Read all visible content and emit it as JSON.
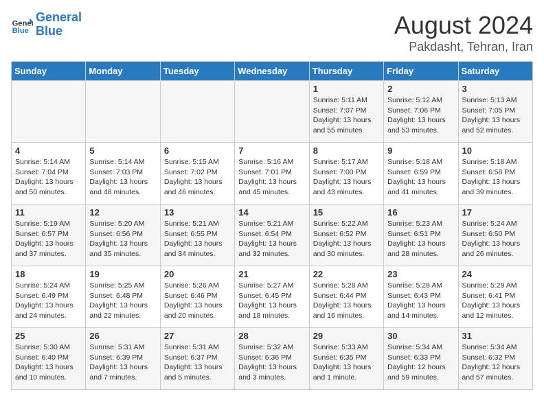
{
  "header": {
    "logo_line1": "General",
    "logo_line2": "Blue",
    "title": "August 2024",
    "subtitle": "Pakdasht, Tehran, Iran"
  },
  "days_of_week": [
    "Sunday",
    "Monday",
    "Tuesday",
    "Wednesday",
    "Thursday",
    "Friday",
    "Saturday"
  ],
  "weeks": [
    [
      {
        "day": "",
        "info": ""
      },
      {
        "day": "",
        "info": ""
      },
      {
        "day": "",
        "info": ""
      },
      {
        "day": "",
        "info": ""
      },
      {
        "day": "1",
        "info": "Sunrise: 5:11 AM\nSunset: 7:07 PM\nDaylight: 13 hours\nand 55 minutes."
      },
      {
        "day": "2",
        "info": "Sunrise: 5:12 AM\nSunset: 7:06 PM\nDaylight: 13 hours\nand 53 minutes."
      },
      {
        "day": "3",
        "info": "Sunrise: 5:13 AM\nSunset: 7:05 PM\nDaylight: 13 hours\nand 52 minutes."
      }
    ],
    [
      {
        "day": "4",
        "info": "Sunrise: 5:14 AM\nSunset: 7:04 PM\nDaylight: 13 hours\nand 50 minutes."
      },
      {
        "day": "5",
        "info": "Sunrise: 5:14 AM\nSunset: 7:03 PM\nDaylight: 13 hours\nand 48 minutes."
      },
      {
        "day": "6",
        "info": "Sunrise: 5:15 AM\nSunset: 7:02 PM\nDaylight: 13 hours\nand 46 minutes."
      },
      {
        "day": "7",
        "info": "Sunrise: 5:16 AM\nSunset: 7:01 PM\nDaylight: 13 hours\nand 45 minutes."
      },
      {
        "day": "8",
        "info": "Sunrise: 5:17 AM\nSunset: 7:00 PM\nDaylight: 13 hours\nand 43 minutes."
      },
      {
        "day": "9",
        "info": "Sunrise: 5:18 AM\nSunset: 6:59 PM\nDaylight: 13 hours\nand 41 minutes."
      },
      {
        "day": "10",
        "info": "Sunrise: 5:18 AM\nSunset: 6:58 PM\nDaylight: 13 hours\nand 39 minutes."
      }
    ],
    [
      {
        "day": "11",
        "info": "Sunrise: 5:19 AM\nSunset: 6:57 PM\nDaylight: 13 hours\nand 37 minutes."
      },
      {
        "day": "12",
        "info": "Sunrise: 5:20 AM\nSunset: 6:56 PM\nDaylight: 13 hours\nand 35 minutes."
      },
      {
        "day": "13",
        "info": "Sunrise: 5:21 AM\nSunset: 6:55 PM\nDaylight: 13 hours\nand 34 minutes."
      },
      {
        "day": "14",
        "info": "Sunrise: 5:21 AM\nSunset: 6:54 PM\nDaylight: 13 hours\nand 32 minutes."
      },
      {
        "day": "15",
        "info": "Sunrise: 5:22 AM\nSunset: 6:52 PM\nDaylight: 13 hours\nand 30 minutes."
      },
      {
        "day": "16",
        "info": "Sunrise: 5:23 AM\nSunset: 6:51 PM\nDaylight: 13 hours\nand 28 minutes."
      },
      {
        "day": "17",
        "info": "Sunrise: 5:24 AM\nSunset: 6:50 PM\nDaylight: 13 hours\nand 26 minutes."
      }
    ],
    [
      {
        "day": "18",
        "info": "Sunrise: 5:24 AM\nSunset: 6:49 PM\nDaylight: 13 hours\nand 24 minutes."
      },
      {
        "day": "19",
        "info": "Sunrise: 5:25 AM\nSunset: 6:48 PM\nDaylight: 13 hours\nand 22 minutes."
      },
      {
        "day": "20",
        "info": "Sunrise: 5:26 AM\nSunset: 6:46 PM\nDaylight: 13 hours\nand 20 minutes."
      },
      {
        "day": "21",
        "info": "Sunrise: 5:27 AM\nSunset: 6:45 PM\nDaylight: 13 hours\nand 18 minutes."
      },
      {
        "day": "22",
        "info": "Sunrise: 5:28 AM\nSunset: 6:44 PM\nDaylight: 13 hours\nand 16 minutes."
      },
      {
        "day": "23",
        "info": "Sunrise: 5:28 AM\nSunset: 6:43 PM\nDaylight: 13 hours\nand 14 minutes."
      },
      {
        "day": "24",
        "info": "Sunrise: 5:29 AM\nSunset: 6:41 PM\nDaylight: 13 hours\nand 12 minutes."
      }
    ],
    [
      {
        "day": "25",
        "info": "Sunrise: 5:30 AM\nSunset: 6:40 PM\nDaylight: 13 hours\nand 10 minutes."
      },
      {
        "day": "26",
        "info": "Sunrise: 5:31 AM\nSunset: 6:39 PM\nDaylight: 13 hours\nand 7 minutes."
      },
      {
        "day": "27",
        "info": "Sunrise: 5:31 AM\nSunset: 6:37 PM\nDaylight: 13 hours\nand 5 minutes."
      },
      {
        "day": "28",
        "info": "Sunrise: 5:32 AM\nSunset: 6:36 PM\nDaylight: 13 hours\nand 3 minutes."
      },
      {
        "day": "29",
        "info": "Sunrise: 5:33 AM\nSunset: 6:35 PM\nDaylight: 13 hours\nand 1 minute."
      },
      {
        "day": "30",
        "info": "Sunrise: 5:34 AM\nSunset: 6:33 PM\nDaylight: 12 hours\nand 59 minutes."
      },
      {
        "day": "31",
        "info": "Sunrise: 5:34 AM\nSunset: 6:32 PM\nDaylight: 12 hours\nand 57 minutes."
      }
    ]
  ]
}
